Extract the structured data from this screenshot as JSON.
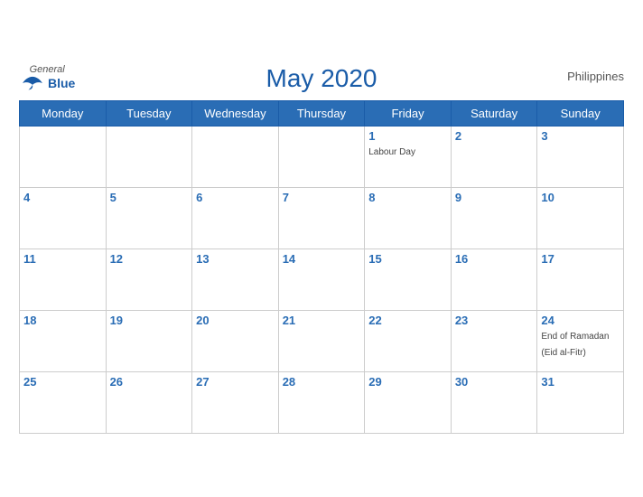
{
  "header": {
    "title": "May 2020",
    "country": "Philippines",
    "logo_general": "General",
    "logo_blue": "Blue"
  },
  "weekdays": [
    "Monday",
    "Tuesday",
    "Wednesday",
    "Thursday",
    "Friday",
    "Saturday",
    "Sunday"
  ],
  "weeks": [
    [
      {
        "day": "",
        "event": ""
      },
      {
        "day": "",
        "event": ""
      },
      {
        "day": "",
        "event": ""
      },
      {
        "day": "",
        "event": ""
      },
      {
        "day": "1",
        "event": "Labour Day"
      },
      {
        "day": "2",
        "event": ""
      },
      {
        "day": "3",
        "event": ""
      }
    ],
    [
      {
        "day": "4",
        "event": ""
      },
      {
        "day": "5",
        "event": ""
      },
      {
        "day": "6",
        "event": ""
      },
      {
        "day": "7",
        "event": ""
      },
      {
        "day": "8",
        "event": ""
      },
      {
        "day": "9",
        "event": ""
      },
      {
        "day": "10",
        "event": ""
      }
    ],
    [
      {
        "day": "11",
        "event": ""
      },
      {
        "day": "12",
        "event": ""
      },
      {
        "day": "13",
        "event": ""
      },
      {
        "day": "14",
        "event": ""
      },
      {
        "day": "15",
        "event": ""
      },
      {
        "day": "16",
        "event": ""
      },
      {
        "day": "17",
        "event": ""
      }
    ],
    [
      {
        "day": "18",
        "event": ""
      },
      {
        "day": "19",
        "event": ""
      },
      {
        "day": "20",
        "event": ""
      },
      {
        "day": "21",
        "event": ""
      },
      {
        "day": "22",
        "event": ""
      },
      {
        "day": "23",
        "event": ""
      },
      {
        "day": "24",
        "event": "End of Ramadan (Eid al-Fitr)"
      }
    ],
    [
      {
        "day": "25",
        "event": ""
      },
      {
        "day": "26",
        "event": ""
      },
      {
        "day": "27",
        "event": ""
      },
      {
        "day": "28",
        "event": ""
      },
      {
        "day": "29",
        "event": ""
      },
      {
        "day": "30",
        "event": ""
      },
      {
        "day": "31",
        "event": ""
      }
    ]
  ]
}
